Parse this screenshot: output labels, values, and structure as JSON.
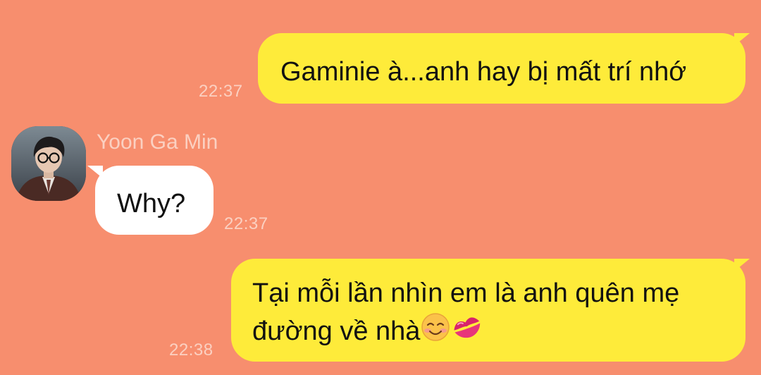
{
  "conversation": {
    "messages": [
      {
        "direction": "outgoing",
        "text": "Gaminie à...anh hay bị mất trí nhớ",
        "time": "22:37"
      },
      {
        "direction": "incoming",
        "sender": "Yoon Ga Min",
        "text": "Why?",
        "time": "22:37"
      },
      {
        "direction": "outgoing",
        "text_line1": "Tại mỗi lần nhìn em là anh quên mẹ",
        "text_line2": "đường về nhà",
        "time": "22:38"
      }
    ]
  },
  "colors": {
    "background": "#F78E6E",
    "outgoing_bubble": "#FEEB3A",
    "incoming_bubble": "#FFFFFF",
    "meta_text": "#FBD0C1"
  }
}
